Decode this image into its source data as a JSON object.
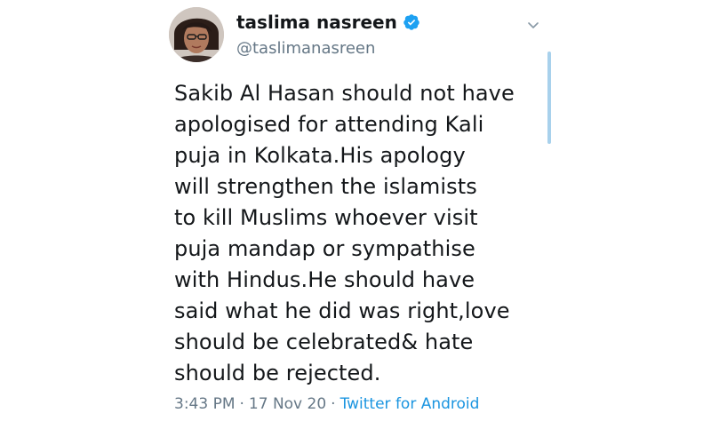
{
  "user": {
    "display_name": "taslima nasreen",
    "handle": "@taslimanasreen",
    "verified_icon": "verified-badge-icon",
    "avatar_icon": "avatar"
  },
  "tweet": {
    "text": "Sakib Al Hasan should not have\napologised for attending Kali\npuja in Kolkata.His apology\nwill strengthen the islamists\nto kill Muslims whoever visit\npuja mandap or sympathise\nwith Hindus.He should have\nsaid what he did was right,love\nshould be celebrated& hate\nshould be rejected.",
    "time": "3:43 PM",
    "separator": "·",
    "date": "17 Nov 20",
    "source": "Twitter for Android"
  },
  "menu": {
    "caret_icon": "chevron-down-icon"
  },
  "colors": {
    "text": "#14171a",
    "muted": "#657786",
    "link": "#1b95e0",
    "verified": "#1da1f2",
    "scrollbar": "#a8d1ec"
  }
}
